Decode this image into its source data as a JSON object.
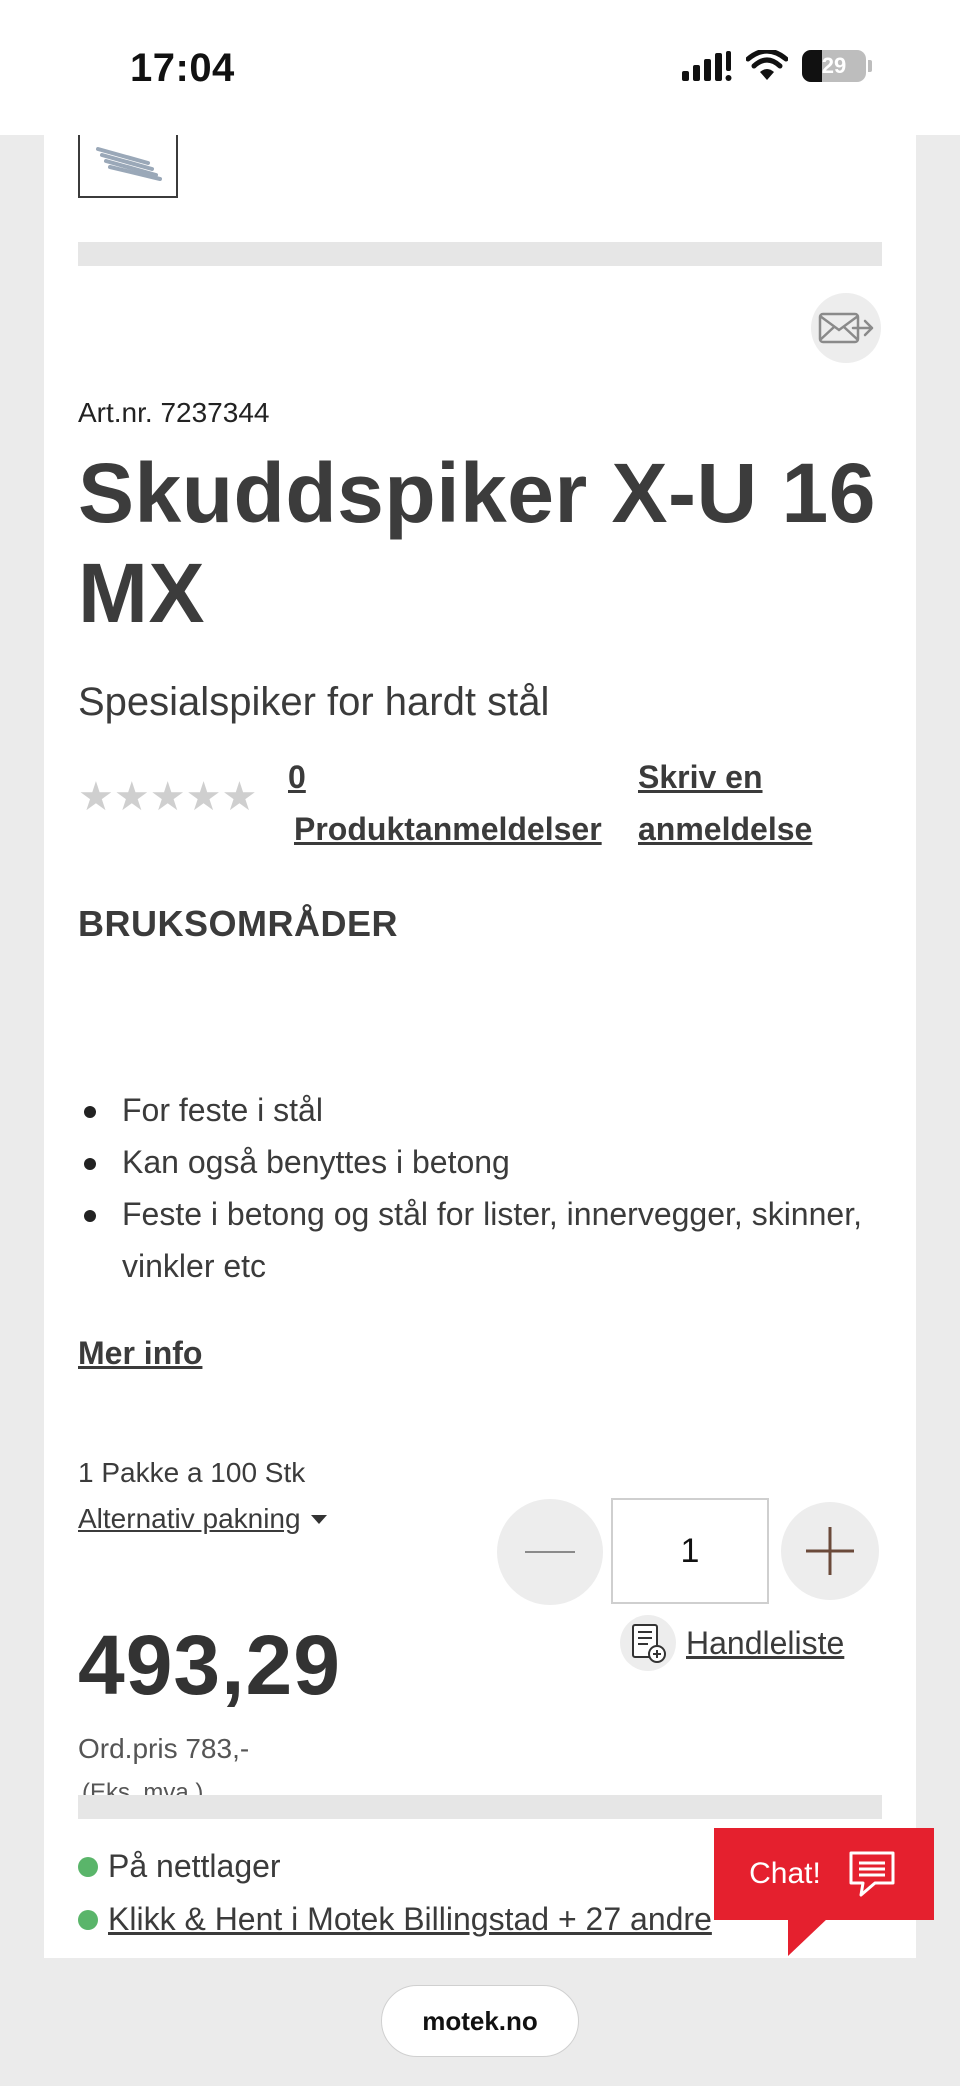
{
  "status_bar": {
    "time": "17:04",
    "battery": "29"
  },
  "product": {
    "art_nr": "Art.nr. 7237344",
    "title": "Skuddspiker X-U 16 MX",
    "subtitle": "Spesialspiker for hardt stål",
    "rating_stars": "★★★★★",
    "review_count": "0",
    "review_label": "Produktanmeldelser",
    "write_review": "Skriv en anmeldelse"
  },
  "uses": {
    "heading": "BRUKSOMRÅDER",
    "items": [
      "For feste i stål",
      "Kan også benyttes i betong",
      "Feste i betong og stål for lister, innervegger, skinner, vinkler etc"
    ],
    "more_info": "Mer info"
  },
  "packaging": {
    "info": "1 Pakke a 100 Stk",
    "alternative": "Alternativ pakning "
  },
  "pricing": {
    "price": "493,29",
    "ordinary": "Ord.pris 783,-",
    "vat_note": "(Eks. mva.)"
  },
  "quantity": {
    "value": "1"
  },
  "shopping_list": {
    "label": "Handleliste"
  },
  "stock": {
    "online": "På nettlager",
    "click_collect": "Klikk & Hent i Motek Billingstad + 27 andre",
    "status_color": "#5ab56a"
  },
  "chat": {
    "label": "Chat!",
    "color": "#e5202e"
  },
  "browser": {
    "url": "motek.no"
  }
}
